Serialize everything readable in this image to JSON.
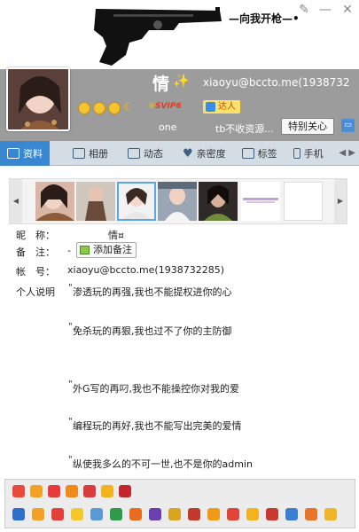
{
  "header": {
    "gun_title": "向我开枪",
    "gun_title_prefix": "—",
    "gun_title_suffix": "—•",
    "name_big": "情",
    "email": "xiaoyu@bccto.me(1938732",
    "nick_sub": "one",
    "signature_sub": "tb不收资源...",
    "care_button": "特别关心",
    "svip_label": "SVIP6",
    "daren_label": "达人"
  },
  "tabs": [
    {
      "label": "资料",
      "active": true
    },
    {
      "label": "相册",
      "active": false
    },
    {
      "label": "动态",
      "active": false
    },
    {
      "label": "亲密度",
      "active": false
    },
    {
      "label": "标签",
      "active": false
    },
    {
      "label": "手机",
      "active": false
    }
  ],
  "profile": {
    "nickname_label": "昵　称：",
    "nickname_value": "情¤",
    "remark_label": "备　注：",
    "remark_value": "-",
    "add_remark_button": "添加备注",
    "account_label": "帐　号：",
    "account_value": "xiaoyu@bccto.me(1938732285)",
    "bio_label": "个人说明"
  },
  "bio_lines": [
    "渗透玩的再强,我也不能提权进你的心",
    "免杀玩的再狠,我也过不了你的主防御",
    "外G写的再叼,我也不能操控你对我的爱",
    "编程玩的再好,我也不能写出完美的爱情",
    "纵使我多么的不可一世,也不是你的admin"
  ],
  "colors": {
    "tab_active": "#3a87d1",
    "header_gray": "#9c9c9c",
    "tab_bar": "#d5dde4"
  }
}
